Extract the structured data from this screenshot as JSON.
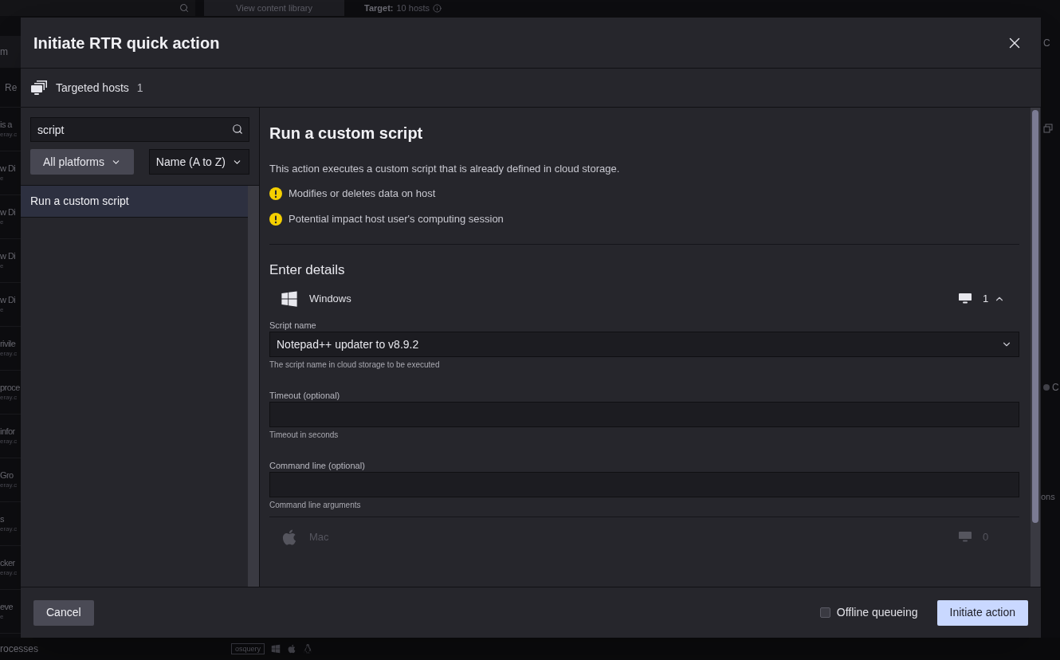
{
  "background": {
    "library_button": "View content library",
    "target_label": "Target:",
    "target_value": "10 hosts",
    "filter": "m",
    "column_header": "Re",
    "rows": [
      {
        "title": "is a",
        "subtitle": "eray.c"
      },
      {
        "title": "w Di",
        "subtitle": "e"
      },
      {
        "title": "w Di",
        "subtitle": "e"
      },
      {
        "title": "w Di",
        "subtitle": "e"
      },
      {
        "title": "w Di",
        "subtitle": "e"
      },
      {
        "title": "rivile",
        "subtitle": "eray.c"
      },
      {
        "title": "proce",
        "subtitle": "eray.c"
      },
      {
        "title": "infor",
        "subtitle": "eray.c"
      },
      {
        "title": "Gro",
        "subtitle": "eray.c"
      },
      {
        "title": "s",
        "subtitle": "eray.c"
      },
      {
        "title": "cker",
        "subtitle": "eray.c"
      },
      {
        "title": "eve",
        "subtitle": "e"
      }
    ],
    "footer_row": "rocesses",
    "badge": "osquery",
    "right_fragments": [
      "C",
      "C",
      "ons"
    ]
  },
  "modal": {
    "title": "Initiate RTR quick action",
    "targeted_label": "Targeted hosts",
    "targeted_count": "1",
    "search": {
      "value": "script"
    },
    "platform_filter": "All platforms",
    "sort": "Name (A to Z)",
    "actions": [
      {
        "label": "Run a custom script",
        "selected": true
      }
    ],
    "detail": {
      "title": "Run a custom script",
      "description": "This action executes a custom script that is already defined in cloud storage.",
      "warnings": [
        "Modifies or deletes data on host",
        "Potential impact host user's computing session"
      ],
      "section": "Enter details",
      "platforms": [
        {
          "kind": "windows",
          "name": "Windows",
          "count": "1",
          "expanded": true,
          "disabled": false,
          "fields": [
            {
              "kind": "select",
              "label": "Script name",
              "value": "Notepad++ updater to v8.9.2",
              "help": "The script name in cloud storage to be executed"
            },
            {
              "kind": "text",
              "label": "Timeout (optional)",
              "help": "Timeout in seconds"
            },
            {
              "kind": "text",
              "label": "Command line (optional)",
              "help": "Command line arguments"
            }
          ]
        },
        {
          "kind": "mac",
          "name": "Mac",
          "count": "0",
          "expanded": false,
          "disabled": true
        }
      ]
    },
    "footer": {
      "cancel": "Cancel",
      "offline": {
        "label": "Offline queueing",
        "checked": false
      },
      "initiate": "Initiate action"
    }
  }
}
